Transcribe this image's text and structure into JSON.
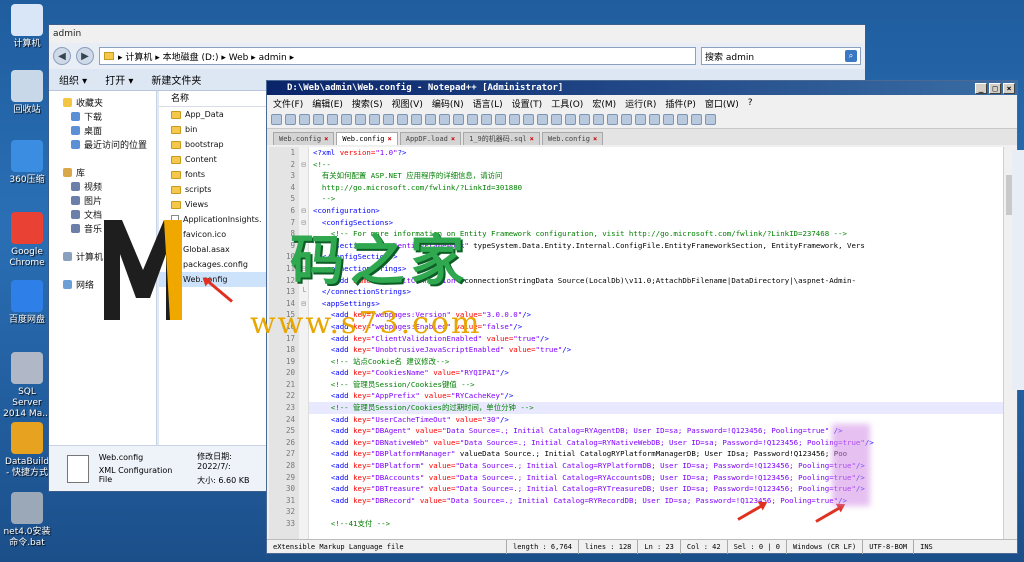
{
  "desktop": {
    "icons": [
      {
        "label": "计算机",
        "icon": "computer-icon",
        "color": "#d8e6f7"
      },
      {
        "label": "回收站",
        "icon": "recycle-bin-icon",
        "color": "#c8d8e8"
      },
      {
        "label": "360压缩",
        "icon": "archive-icon",
        "color": "#3a8de0"
      },
      {
        "label": "Google Chrome",
        "icon": "chrome-icon",
        "color": "#e94235"
      },
      {
        "label": "百度网盘",
        "icon": "cloud-drive-icon",
        "color": "#2f7fe8"
      },
      {
        "label": "SQL Server 2014 Ma...",
        "icon": "sql-server-icon",
        "color": "#b0b8c8"
      },
      {
        "label": "DataBuild - 快捷方式",
        "icon": "databuild-icon",
        "color": "#e7a320"
      },
      {
        "label": "net4.0安装命令.bat",
        "icon": "gear-icon",
        "color": "#9aa8b8"
      }
    ]
  },
  "explorer": {
    "title": "admin",
    "breadcrumb": "▸ 计算机 ▸ 本地磁盘 (D:) ▸ Web ▸ admin ▸",
    "search_placeholder": "搜索 admin",
    "commands": [
      "组织 ▾",
      "打开 ▾",
      "新建文件夹"
    ],
    "nav": [
      {
        "label": "收藏夹",
        "level": 0,
        "color": "#f2c542"
      },
      {
        "label": "下载",
        "level": 1,
        "color": "#5b8fd6"
      },
      {
        "label": "桌面",
        "level": 1,
        "color": "#5b8fd6"
      },
      {
        "label": "最近访问的位置",
        "level": 1,
        "color": "#5b8fd6"
      },
      {
        "label": "",
        "level": 0,
        "color": ""
      },
      {
        "label": "库",
        "level": 0,
        "color": "#d8a84a"
      },
      {
        "label": "视频",
        "level": 1,
        "color": "#6b7fa8"
      },
      {
        "label": "图片",
        "level": 1,
        "color": "#6b7fa8"
      },
      {
        "label": "文档",
        "level": 1,
        "color": "#6b7fa8"
      },
      {
        "label": "音乐",
        "level": 1,
        "color": "#6b7fa8"
      },
      {
        "label": "",
        "level": 0,
        "color": ""
      },
      {
        "label": "计算机",
        "level": 0,
        "color": "#8aa0bf"
      },
      {
        "label": "",
        "level": 0,
        "color": ""
      },
      {
        "label": "网络",
        "level": 0,
        "color": "#6b9fd6"
      }
    ],
    "column_header": "名称",
    "files": [
      {
        "name": "App_Data",
        "type": "folder"
      },
      {
        "name": "bin",
        "type": "folder"
      },
      {
        "name": "bootstrap",
        "type": "folder"
      },
      {
        "name": "Content",
        "type": "folder"
      },
      {
        "name": "fonts",
        "type": "folder"
      },
      {
        "name": "scripts",
        "type": "folder"
      },
      {
        "name": "Views",
        "type": "folder"
      },
      {
        "name": "ApplicationInsights.",
        "type": "file"
      },
      {
        "name": "favicon.ico",
        "type": "file"
      },
      {
        "name": "Global.asax",
        "type": "file"
      },
      {
        "name": "packages.config",
        "type": "file"
      },
      {
        "name": "Web.config",
        "type": "file",
        "selected": true
      }
    ],
    "details": {
      "name": "Web.config",
      "type": "XML Configuration File",
      "modified_label": "修改日期: 2022/7/:",
      "size_label": "大小: 6.60 KB"
    }
  },
  "notepad": {
    "title": "D:\\Web\\admin\\Web.config - Notepad++ [Administrator]",
    "menu": [
      "文件(F)",
      "编辑(E)",
      "搜索(S)",
      "视图(V)",
      "编码(N)",
      "语言(L)",
      "设置(T)",
      "工具(O)",
      "宏(M)",
      "运行(R)",
      "插件(P)",
      "窗口(W)",
      "?"
    ],
    "tabs": [
      {
        "label": "Web.config",
        "active": false
      },
      {
        "label": "Web.config",
        "active": true
      },
      {
        "label": "AppDF.load",
        "active": false
      },
      {
        "label": "1_9的机器码.sql",
        "active": false
      },
      {
        "label": "Web.config",
        "active": false
      }
    ],
    "status": {
      "file_type": "eXtensible Markup Language file",
      "length": "length : 6,764",
      "lines": "lines : 128",
      "ln": "Ln : 23",
      "col": "Col : 42",
      "sel": "Sel : 0 | 0",
      "eol": "Windows (CR LF)",
      "encoding": "UTF-8-BOM",
      "mode": "INS"
    },
    "lines": [
      "<?xml version=\"1.0\"?>",
      "<!--",
      "  有关如何配置 ASP.NET 应用程序的详细信息，请访问",
      "  http://go.microsoft.com/fwlink/?LinkId=301880",
      "  -->",
      "<configuration>",
      "  <configSections>",
      "    <!-- For more information on Entity Framework configuration, visit http://go.microsoft.com/fwlink/?LinkID=237468 -->",
      "    <section name=\"entityFramework\" type=\"System.Data.Entity.Internal.ConfigFile.EntityFrameworkSection, EntityFramework, Vers",
      "  </configSections>",
      "  <connectionStrings>",
      "    <add name=\"DefaultConnection\" connectionString=\"Data Source=(LocalDb)\\v11.0;AttachDbFilename=|DataDirectory|\\aspnet-Admin-",
      "  </connectionStrings>",
      "  <appSettings>",
      "    <add key=\"webpages:Version\" value=\"3.0.0.0\"/>",
      "    <add key=\"webpages:Enabled\" value=\"false\"/>",
      "    <add key=\"ClientValidationEnabled\" value=\"true\"/>",
      "    <add key=\"UnobtrusiveJavaScriptEnabled\" value=\"true\"/>",
      "    <!-- 站点Cookie名 建议修改-->",
      "    <add key=\"CookiesName\" value=\"RYQIPAI\"/>",
      "    <!-- 管理员Session/Cookies键值 -->",
      "    <add key=\"AppPrefix\" value=\"RYCacheKey\"/>",
      "    <!-- 管理员Session/Cookies的过期时间，单位分钟 -->",
      "    <add key=\"UserCacheTimeOut\" value=\"30\"/>",
      "    <add key=\"DBAgent\" value=\"Data Source=.; Initial Catalog=RYAgentDB; User ID=sa; Password=!Q123456; Pooling=true\" />",
      "    <add key=\"DBNativeWeb\" value=\"Data Source=.; Initial Catalog=RYNativeWebDB; User ID=sa; Password=!Q123456; Pooling=true\"/>",
      "    <add key=\"DBPlatformManager\" value=\"Data Source=.; Initial Catalog=RYPlatformManagerDB; User ID=sa; Password=!Q123456; Poo",
      "    <add key=\"DBPlatform\" value=\"Data Source=.; Initial Catalog=RYPlatformDB; User ID=sa; Password=!Q123456; Pooling=true\"/>",
      "    <add key=\"DBAccounts\" value=\"Data Source=.; Initial Catalog=RYAccountsDB; User ID=sa; Password=!Q123456; Pooling=true\"/>",
      "    <add key=\"DBTreasure\" value=\"Data Source=.; Initial Catalog=RYTreasureDB; User ID=sa; Password=!Q123456; Pooling=true\"/>",
      "    <add key=\"DBRecord\" value=\"Data Source=.; Initial Catalog=RYRecordDB; User ID=sa; Password=!Q123456; Pooling=true\"/>",
      "",
      "    <!--41支付 -->"
    ],
    "current_line": 23
  },
  "watermark": {
    "title": "码之家",
    "url": "www.s73.com"
  },
  "colors": {
    "accent": "#0a246a",
    "tag": "#0000ff",
    "attr": "#ff0000",
    "value": "#8000ff",
    "comment": "#008000",
    "arrow": "#e03020"
  }
}
